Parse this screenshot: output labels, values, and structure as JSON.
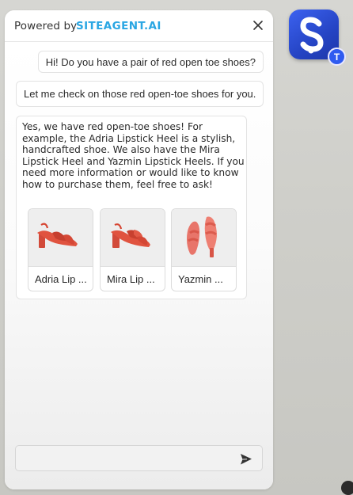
{
  "header": {
    "powered_by": "Powered by",
    "brand": "SITEAGENT.AI",
    "brand_color": "#29a6e3",
    "close_icon": "close-icon"
  },
  "messages": [
    {
      "role": "user",
      "text": "Hi! Do you have a pair of red open toe shoes?"
    },
    {
      "role": "bot",
      "text": "Let me check on those red open-toe shoes for you."
    },
    {
      "role": "bot",
      "text": "Yes, we have red open-toe shoes! For example, the Adria Lipstick Heel is a stylish, handcrafted shoe. We also have the Mira Lipstick Heel and Yazmin Lipstick Heels. If you need more information or would like to know how to purchase them, feel free to ask!"
    }
  ],
  "products": [
    {
      "label": "Adria Lip ..."
    },
    {
      "label": "Mira Lip ..."
    },
    {
      "label": "Yazmin ..."
    }
  ],
  "composer": {
    "placeholder": "",
    "value": "",
    "send_icon": "send-icon"
  },
  "launcher": {
    "icon": "siteagent-logo-icon",
    "badge": "T",
    "accent": "#2f5bf0"
  }
}
